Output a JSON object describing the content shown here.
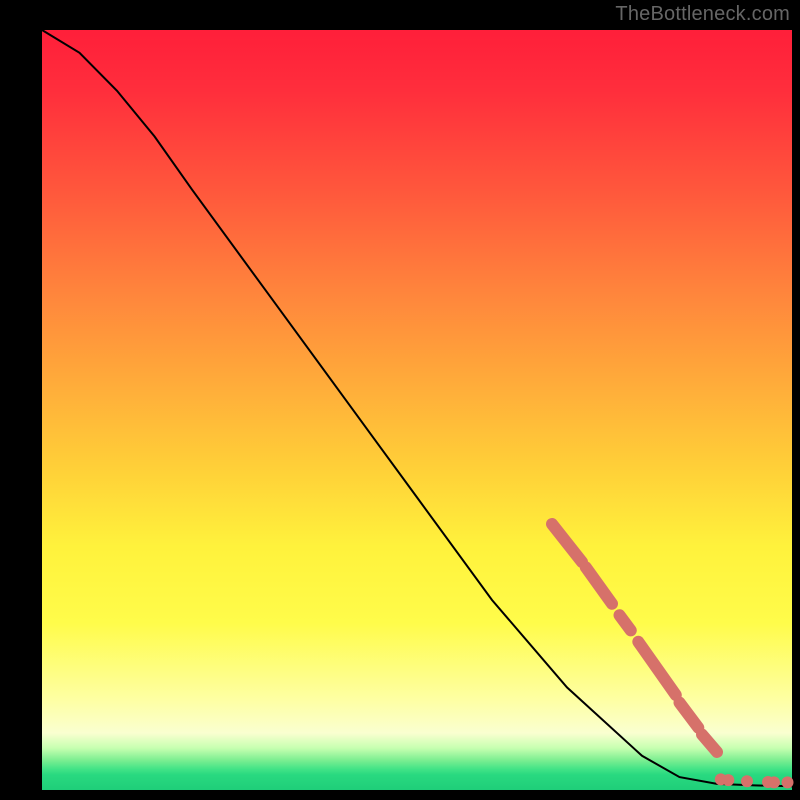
{
  "attribution": "TheBottleneck.com",
  "chart_data": {
    "type": "line",
    "title": "",
    "xlabel": "",
    "ylabel": "",
    "xlim": [
      0,
      100
    ],
    "ylim": [
      0,
      100
    ],
    "curve": [
      {
        "x": 0,
        "y": 100
      },
      {
        "x": 5,
        "y": 97
      },
      {
        "x": 10,
        "y": 92
      },
      {
        "x": 15,
        "y": 86
      },
      {
        "x": 20,
        "y": 79
      },
      {
        "x": 30,
        "y": 65.5
      },
      {
        "x": 40,
        "y": 52
      },
      {
        "x": 50,
        "y": 38.5
      },
      {
        "x": 60,
        "y": 25
      },
      {
        "x": 70,
        "y": 13.5
      },
      {
        "x": 80,
        "y": 4.5
      },
      {
        "x": 85,
        "y": 1.7
      },
      {
        "x": 90,
        "y": 0.8
      },
      {
        "x": 95,
        "y": 0.6
      },
      {
        "x": 100,
        "y": 0.5
      }
    ],
    "highlight_segments": [
      {
        "x1": 68,
        "y1": 35,
        "x2": 72,
        "y2": 30
      },
      {
        "x1": 72.5,
        "y1": 29.3,
        "x2": 76,
        "y2": 24.5
      },
      {
        "x1": 77,
        "y1": 23,
        "x2": 78.5,
        "y2": 21
      },
      {
        "x1": 79.5,
        "y1": 19.5,
        "x2": 84.5,
        "y2": 12.5
      },
      {
        "x1": 85,
        "y1": 11.5,
        "x2": 87.5,
        "y2": 8.2
      },
      {
        "x1": 88,
        "y1": 7.3,
        "x2": 90,
        "y2": 5
      }
    ],
    "highlight_points": [
      {
        "x": 90.5,
        "y": 1.4
      },
      {
        "x": 91.5,
        "y": 1.3
      },
      {
        "x": 94.0,
        "y": 1.15
      },
      {
        "x": 96.8,
        "y": 1.05
      },
      {
        "x": 97.6,
        "y": 1.0
      },
      {
        "x": 99.4,
        "y": 1.0
      }
    ]
  }
}
